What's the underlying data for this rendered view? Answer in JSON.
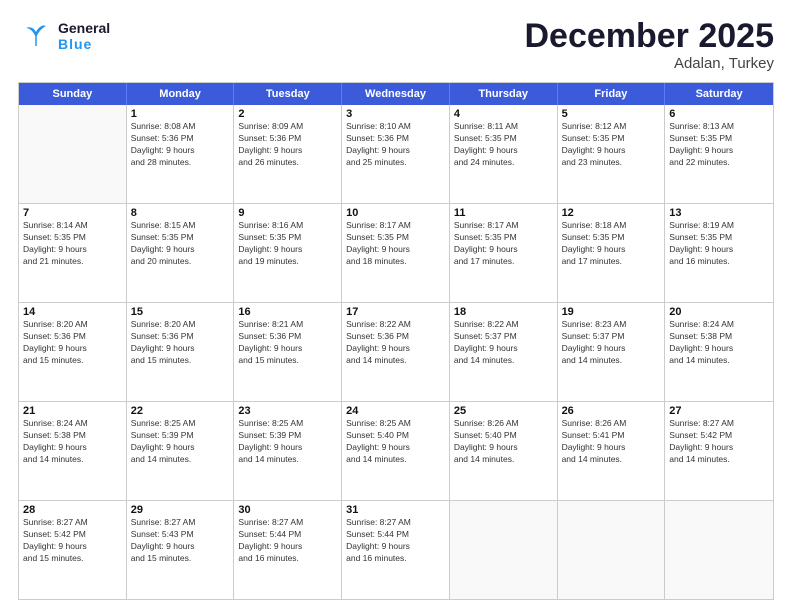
{
  "header": {
    "logo_general": "General",
    "logo_blue": "Blue",
    "main_title": "December 2025",
    "subtitle": "Adalan, Turkey"
  },
  "calendar": {
    "days_of_week": [
      "Sunday",
      "Monday",
      "Tuesday",
      "Wednesday",
      "Thursday",
      "Friday",
      "Saturday"
    ],
    "rows": [
      [
        {
          "day": "",
          "info": ""
        },
        {
          "day": "1",
          "info": "Sunrise: 8:08 AM\nSunset: 5:36 PM\nDaylight: 9 hours\nand 28 minutes."
        },
        {
          "day": "2",
          "info": "Sunrise: 8:09 AM\nSunset: 5:36 PM\nDaylight: 9 hours\nand 26 minutes."
        },
        {
          "day": "3",
          "info": "Sunrise: 8:10 AM\nSunset: 5:36 PM\nDaylight: 9 hours\nand 25 minutes."
        },
        {
          "day": "4",
          "info": "Sunrise: 8:11 AM\nSunset: 5:35 PM\nDaylight: 9 hours\nand 24 minutes."
        },
        {
          "day": "5",
          "info": "Sunrise: 8:12 AM\nSunset: 5:35 PM\nDaylight: 9 hours\nand 23 minutes."
        },
        {
          "day": "6",
          "info": "Sunrise: 8:13 AM\nSunset: 5:35 PM\nDaylight: 9 hours\nand 22 minutes."
        }
      ],
      [
        {
          "day": "7",
          "info": "Sunrise: 8:14 AM\nSunset: 5:35 PM\nDaylight: 9 hours\nand 21 minutes."
        },
        {
          "day": "8",
          "info": "Sunrise: 8:15 AM\nSunset: 5:35 PM\nDaylight: 9 hours\nand 20 minutes."
        },
        {
          "day": "9",
          "info": "Sunrise: 8:16 AM\nSunset: 5:35 PM\nDaylight: 9 hours\nand 19 minutes."
        },
        {
          "day": "10",
          "info": "Sunrise: 8:17 AM\nSunset: 5:35 PM\nDaylight: 9 hours\nand 18 minutes."
        },
        {
          "day": "11",
          "info": "Sunrise: 8:17 AM\nSunset: 5:35 PM\nDaylight: 9 hours\nand 17 minutes."
        },
        {
          "day": "12",
          "info": "Sunrise: 8:18 AM\nSunset: 5:35 PM\nDaylight: 9 hours\nand 17 minutes."
        },
        {
          "day": "13",
          "info": "Sunrise: 8:19 AM\nSunset: 5:35 PM\nDaylight: 9 hours\nand 16 minutes."
        }
      ],
      [
        {
          "day": "14",
          "info": "Sunrise: 8:20 AM\nSunset: 5:36 PM\nDaylight: 9 hours\nand 15 minutes."
        },
        {
          "day": "15",
          "info": "Sunrise: 8:20 AM\nSunset: 5:36 PM\nDaylight: 9 hours\nand 15 minutes."
        },
        {
          "day": "16",
          "info": "Sunrise: 8:21 AM\nSunset: 5:36 PM\nDaylight: 9 hours\nand 15 minutes."
        },
        {
          "day": "17",
          "info": "Sunrise: 8:22 AM\nSunset: 5:36 PM\nDaylight: 9 hours\nand 14 minutes."
        },
        {
          "day": "18",
          "info": "Sunrise: 8:22 AM\nSunset: 5:37 PM\nDaylight: 9 hours\nand 14 minutes."
        },
        {
          "day": "19",
          "info": "Sunrise: 8:23 AM\nSunset: 5:37 PM\nDaylight: 9 hours\nand 14 minutes."
        },
        {
          "day": "20",
          "info": "Sunrise: 8:24 AM\nSunset: 5:38 PM\nDaylight: 9 hours\nand 14 minutes."
        }
      ],
      [
        {
          "day": "21",
          "info": "Sunrise: 8:24 AM\nSunset: 5:38 PM\nDaylight: 9 hours\nand 14 minutes."
        },
        {
          "day": "22",
          "info": "Sunrise: 8:25 AM\nSunset: 5:39 PM\nDaylight: 9 hours\nand 14 minutes."
        },
        {
          "day": "23",
          "info": "Sunrise: 8:25 AM\nSunset: 5:39 PM\nDaylight: 9 hours\nand 14 minutes."
        },
        {
          "day": "24",
          "info": "Sunrise: 8:25 AM\nSunset: 5:40 PM\nDaylight: 9 hours\nand 14 minutes."
        },
        {
          "day": "25",
          "info": "Sunrise: 8:26 AM\nSunset: 5:40 PM\nDaylight: 9 hours\nand 14 minutes."
        },
        {
          "day": "26",
          "info": "Sunrise: 8:26 AM\nSunset: 5:41 PM\nDaylight: 9 hours\nand 14 minutes."
        },
        {
          "day": "27",
          "info": "Sunrise: 8:27 AM\nSunset: 5:42 PM\nDaylight: 9 hours\nand 14 minutes."
        }
      ],
      [
        {
          "day": "28",
          "info": "Sunrise: 8:27 AM\nSunset: 5:42 PM\nDaylight: 9 hours\nand 15 minutes."
        },
        {
          "day": "29",
          "info": "Sunrise: 8:27 AM\nSunset: 5:43 PM\nDaylight: 9 hours\nand 15 minutes."
        },
        {
          "day": "30",
          "info": "Sunrise: 8:27 AM\nSunset: 5:44 PM\nDaylight: 9 hours\nand 16 minutes."
        },
        {
          "day": "31",
          "info": "Sunrise: 8:27 AM\nSunset: 5:44 PM\nDaylight: 9 hours\nand 16 minutes."
        },
        {
          "day": "",
          "info": ""
        },
        {
          "day": "",
          "info": ""
        },
        {
          "day": "",
          "info": ""
        }
      ]
    ]
  }
}
